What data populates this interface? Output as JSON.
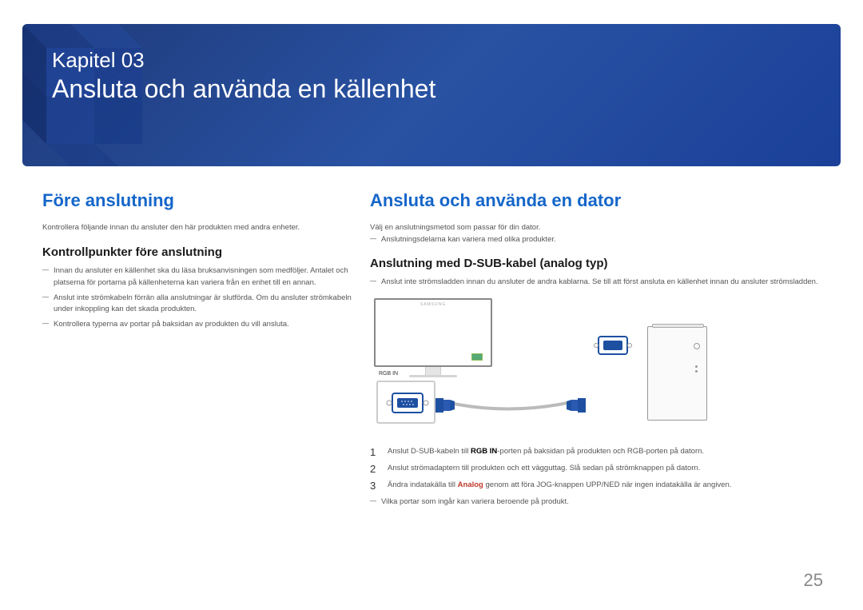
{
  "header": {
    "chapter_label": "Kapitel 03",
    "chapter_title": "Ansluta och använda en källenhet"
  },
  "left": {
    "heading": "Före anslutning",
    "intro": "Kontrollera följande innan du ansluter den här produkten med andra enheter.",
    "subheading": "Kontrollpunkter före anslutning",
    "bullets": [
      "Innan du ansluter en källenhet ska du läsa bruksanvisningen som medföljer. Antalet och platserna för portarna på källenheterna kan variera från en enhet till en annan.",
      "Anslut inte strömkabeln förrän alla anslutningar är slutförda. Om du ansluter strömkabeln under inkoppling kan det skada produkten.",
      "Kontrollera typerna av portar på baksidan av produkten du vill ansluta."
    ]
  },
  "right": {
    "heading": "Ansluta och använda en dator",
    "intro": "Välj en anslutningsmetod som passar för din dator.",
    "intro_note": "Anslutningsdelarna kan variera med olika produkter.",
    "subheading": "Anslutning med D-SUB-kabel (analog typ)",
    "bullets": [
      "Anslut inte strömsladden innan du ansluter de andra kablarna. Se till att först ansluta en källenhet innan du ansluter strömsladden."
    ],
    "rgb_label": "RGB IN",
    "monitor_brand": "SAMSUNG",
    "steps": [
      {
        "n": "1",
        "pre": "Anslut D-SUB-kabeln till ",
        "bold": "RGB IN",
        "post": "-porten på baksidan på produkten och RGB-porten på datorn."
      },
      {
        "n": "2",
        "text": "Anslut strömadaptern till produkten och ett vägguttag. Slå sedan på strömknappen på datorn."
      },
      {
        "n": "3",
        "pre": "Ändra indatakälla till ",
        "red": "Analog",
        "post": " genom att föra JOG-knappen UPP/NED när ingen indatakälla är angiven."
      }
    ],
    "footnote": "Vilka portar som ingår kan variera beroende på produkt."
  },
  "page_number": "25"
}
